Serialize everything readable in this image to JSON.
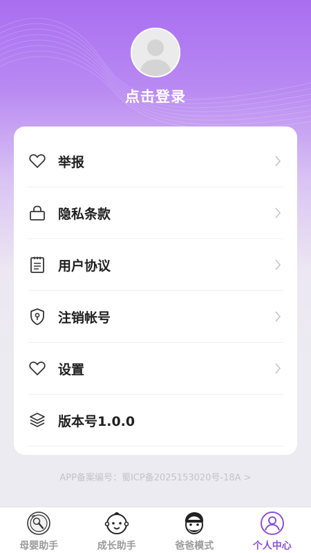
{
  "profile": {
    "login_text": "点击登录"
  },
  "menu": {
    "items": [
      {
        "label": "举报",
        "icon": "heart-icon",
        "has_arrow": true
      },
      {
        "label": "隐私条款",
        "icon": "lock-icon",
        "has_arrow": true
      },
      {
        "label": "用户协议",
        "icon": "document-icon",
        "has_arrow": true
      },
      {
        "label": "注销帐号",
        "icon": "shield-icon",
        "has_arrow": true
      },
      {
        "label": "设置",
        "icon": "heart-icon",
        "has_arrow": true
      },
      {
        "label": "版本号1.0.0",
        "icon": "layers-icon",
        "has_arrow": false
      }
    ]
  },
  "footer": {
    "icp": "APP备案编号：蜀ICP备2025153020号-18A >"
  },
  "tabbar": {
    "tabs": [
      {
        "label": "母婴助手",
        "icon": "baby-rattle-icon",
        "active": false
      },
      {
        "label": "成长助手",
        "icon": "baby-face-icon",
        "active": false
      },
      {
        "label": "爸爸模式",
        "icon": "dad-face-icon",
        "active": false
      },
      {
        "label": "个人中心",
        "icon": "user-icon",
        "active": true
      }
    ]
  },
  "colors": {
    "accent": "#8a4fd8",
    "gradient_top": "#a96ef0",
    "background": "#ecebf1"
  }
}
